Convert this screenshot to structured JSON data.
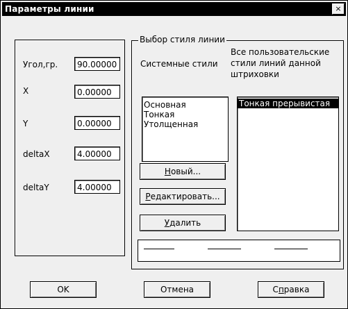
{
  "window": {
    "title": "Параметры линии",
    "close_glyph": "×"
  },
  "params": {
    "angle_label": "Угол,гр.",
    "angle_value": "90.00000",
    "x_label": "X",
    "x_value": "0.00000",
    "y_label": "Y",
    "y_value": "0.00000",
    "deltax_label": "deltaX",
    "deltax_value": "4.00000",
    "deltay_label": "deltaY",
    "deltay_value": "4.00000"
  },
  "style_group": {
    "title": "Выбор стиля линии",
    "system_label": "Системные стили",
    "user_label_lines": [
      "Все пользовательские",
      "стили линий данной",
      "штриховки"
    ],
    "system_styles": [
      "Основная",
      "Тонкая",
      "Утолщенная"
    ],
    "user_styles": [
      {
        "label": "Тонкая прерывистая",
        "selected": true
      }
    ],
    "new_button": {
      "pre": "",
      "accel": "Н",
      "post": "овый..."
    },
    "edit_button": {
      "pre": "",
      "accel": "Р",
      "post": "едактировать..."
    },
    "delete_button": {
      "pre": "",
      "accel": "У",
      "post": "далить"
    }
  },
  "footer": {
    "ok_label": "OK",
    "cancel_label": "Отмена",
    "help_button": {
      "pre": "С",
      "accel": "п",
      "post": "равка"
    }
  },
  "icons": {
    "close": "close-icon"
  }
}
